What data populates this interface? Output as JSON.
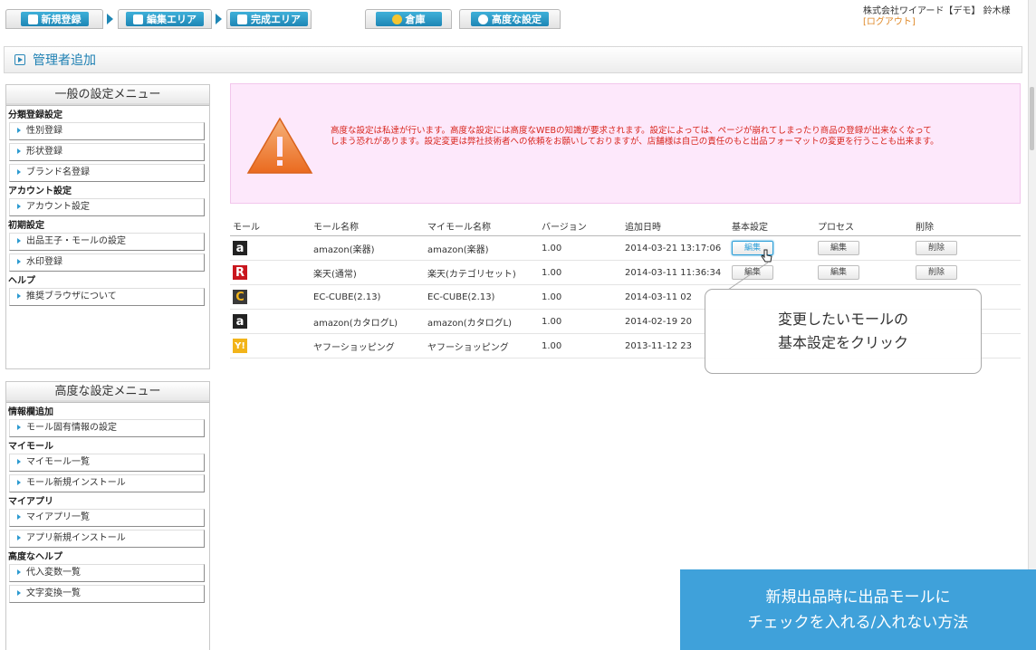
{
  "tabs": {
    "new_registration": "新規登録",
    "edit_area": "編集エリア",
    "complete_area": "完成エリア",
    "warehouse": "倉庫",
    "advanced_settings": "高度な設定"
  },
  "user": {
    "company": "株式会社ワイアード【デモ】 鈴木様",
    "logout": "[ログアウト]"
  },
  "page_title": "管理者追加",
  "general_menu": {
    "title": "一般の設定メニュー",
    "sections": [
      {
        "label": "分類登録設定",
        "items": [
          "性別登録",
          "形状登録",
          "ブランド名登録"
        ]
      },
      {
        "label": "アカウント設定",
        "items": [
          "アカウント設定"
        ]
      },
      {
        "label": "初期設定",
        "items": [
          "出品王子・モールの設定",
          "水印登録"
        ]
      },
      {
        "label": "ヘルプ",
        "items": [
          "推奨ブラウザについて"
        ]
      }
    ]
  },
  "advanced_menu": {
    "title": "高度な設定メニュー",
    "sections": [
      {
        "label": "情報欄追加",
        "items": [
          "モール固有情報の設定"
        ]
      },
      {
        "label": "マイモール",
        "items": [
          "マイモール一覧",
          "モール新規インストール"
        ]
      },
      {
        "label": "マイアプリ",
        "items": [
          "マイアプリ一覧",
          "アプリ新規インストール"
        ]
      },
      {
        "label": "高度なヘルプ",
        "items": [
          "代入変数一覧",
          "文字変換一覧"
        ]
      }
    ]
  },
  "warning": {
    "line1": "高度な設定は私達が行います。高度な設定には高度なWEBの知識が要求されます。設定によっては、ページが崩れてしまったり商品の登録が出来なくなって",
    "line2": "しまう恐れがあります。設定変更は弊社技術者への依頼をお願いしておりますが、店舗様は自己の責任のもと出品フォーマットの変更を行うことも出来ます。"
  },
  "table": {
    "headers": [
      "モール",
      "モール名称",
      "マイモール名称",
      "バージョン",
      "追加日時",
      "基本設定",
      "プロセス",
      "削除"
    ],
    "edit_label": "編集",
    "delete_label": "削除",
    "rows": [
      {
        "logo": "a",
        "logo_color": "#222222",
        "name": "amazon(楽器)",
        "my_name": "amazon(楽器)",
        "version": "1.00",
        "date": "2014-03-21 13:17:06",
        "process": true,
        "delete": true
      },
      {
        "logo": "R",
        "logo_color": "#c9171e",
        "name": "楽天(通常)",
        "my_name": "楽天(カテゴリセット)",
        "version": "1.00",
        "date": "2014-03-11 11:36:34",
        "process": true,
        "delete": true
      },
      {
        "logo": "C",
        "logo_color": "#3a3a3a",
        "name": "EC-CUBE(2.13)",
        "my_name": "EC-CUBE(2.13)",
        "version": "1.00",
        "date": "2014-03-11 02",
        "process": false,
        "delete": false
      },
      {
        "logo": "a",
        "logo_color": "#222222",
        "name": "amazon(カタログL)",
        "my_name": "amazon(カタログL)",
        "version": "1.00",
        "date": "2014-02-19 20",
        "process": false,
        "delete": false
      },
      {
        "logo": "Y!",
        "logo_color": "#f2b41a",
        "name": "ヤフーショッピング",
        "my_name": "ヤフーショッピング",
        "version": "1.00",
        "date": "2013-11-12 23",
        "process": false,
        "delete": false
      }
    ]
  },
  "callout": {
    "line1": "変更したいモールの",
    "line2": "基本設定をクリック"
  },
  "banner": {
    "line1": "新規出品時に出品モールに",
    "line2": "チェックを入れる/入れない方法"
  },
  "colors": {
    "accent": "#1e86b5",
    "warning_bg": "#fde8fb",
    "warning_text": "#d8261e",
    "banner": "#3fa1da"
  }
}
